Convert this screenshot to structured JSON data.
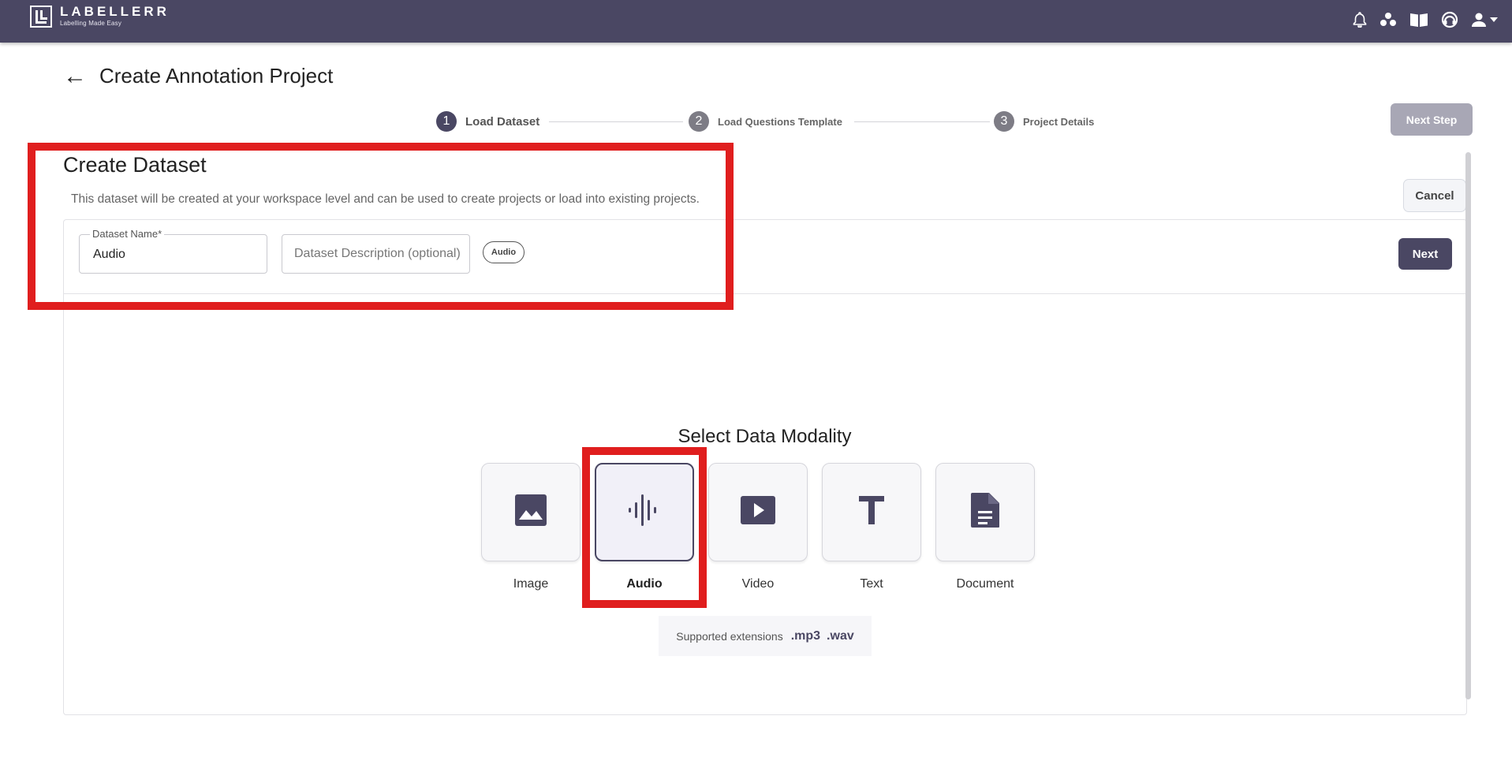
{
  "app": {
    "brand": "LABELLERR",
    "tagline": "Labelling Made Easy"
  },
  "header": {
    "icons": [
      "bell-icon",
      "organization-icon",
      "book-icon",
      "support-icon",
      "user-icon",
      "caret-down-icon"
    ]
  },
  "page": {
    "back_glyph": "←",
    "title": "Create Annotation Project"
  },
  "stepper": {
    "steps": [
      {
        "num": "1",
        "label": "Load Dataset",
        "state": "active"
      },
      {
        "num": "2",
        "label": "Load Questions Template",
        "state": "inactive"
      },
      {
        "num": "3",
        "label": "Project Details",
        "state": "inactive"
      }
    ],
    "next_step_label": "Next Step"
  },
  "create_dataset": {
    "title": "Create Dataset",
    "description": "This dataset will be created at your workspace level and can be used to create projects or load into existing projects.",
    "cancel_label": "Cancel",
    "name_field": {
      "label": "Dataset Name*",
      "value": "Audio"
    },
    "description_field": {
      "placeholder": "Dataset Description (optional)"
    },
    "modality_chip": "Audio",
    "next_label": "Next"
  },
  "modality": {
    "title": "Select Data Modality",
    "options": [
      {
        "label": "Image",
        "icon": "image-icon",
        "selected": false
      },
      {
        "label": "Audio",
        "icon": "audio-wave-icon",
        "selected": true
      },
      {
        "label": "Video",
        "icon": "video-play-icon",
        "selected": false
      },
      {
        "label": "Text",
        "icon": "text-icon",
        "selected": false
      },
      {
        "label": "Document",
        "icon": "document-icon",
        "selected": false
      }
    ],
    "supported_label": "Supported extensions",
    "extensions": [
      ".mp3",
      ".wav"
    ]
  },
  "colors": {
    "topbar": "#4a4763",
    "accent": "#4a4763",
    "annotation_red": "#e01e1e"
  }
}
